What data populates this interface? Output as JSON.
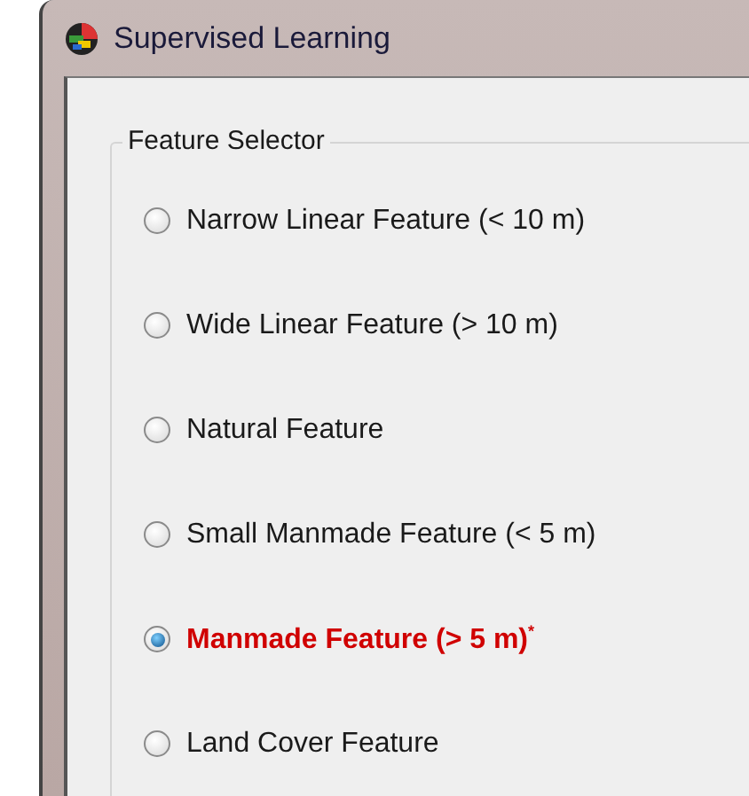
{
  "window": {
    "title": "Supervised Learning"
  },
  "feature_selector": {
    "title": "Feature Selector",
    "options": [
      {
        "label": "Narrow Linear Feature (< 10 m)",
        "selected": false
      },
      {
        "label": "Wide Linear Feature (> 10 m)",
        "selected": false
      },
      {
        "label": "Natural Feature",
        "selected": false
      },
      {
        "label": "Small Manmade Feature (< 5 m)",
        "selected": false
      },
      {
        "label": "Manmade Feature (> 5 m)$^{*}$",
        "selected": true
      },
      {
        "label": "Land Cover Feature",
        "selected": false
      }
    ]
  }
}
